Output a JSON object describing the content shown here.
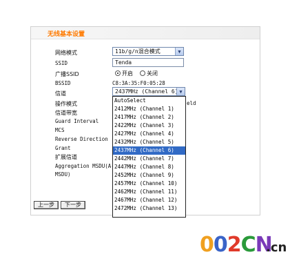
{
  "panel": {
    "title": "无线基本设置"
  },
  "form": {
    "network_mode": {
      "label": "网络模式",
      "value": "11b/g/n混合模式"
    },
    "ssid": {
      "label": "SSID",
      "value": "Tenda"
    },
    "broadcast_ssid": {
      "label": "广播SSID",
      "on_label": "开启",
      "off_label": "关闭",
      "selected": "开启"
    },
    "bssid": {
      "label": "BSSID",
      "value": "C8:3A:35:F0:05:28"
    },
    "channel": {
      "label": "信道",
      "value": "2437MHz (Channel 6)"
    },
    "operating_mode": {
      "label": "操作模式",
      "partial_value": "eld"
    },
    "channel_bandwidth": {
      "label": "信道带宽"
    },
    "guard_interval": {
      "label": "Guard Interval"
    },
    "mcs": {
      "label": "MCS"
    },
    "reverse_direction": {
      "label": "Reverse Direction"
    },
    "grant": {
      "label": "Grant"
    },
    "extension_channel": {
      "label": "扩展信道"
    },
    "aggregation_msdu": {
      "label_line1": "Aggregation MSDU(A-",
      "label_line2": "MSDU)"
    }
  },
  "channel_dropdown": {
    "options": [
      "AutoSelect",
      "2412MHz (Channel 1)",
      "2417MHz (Channel 2)",
      "2422MHz (Channel 3)",
      "2427MHz (Channel 4)",
      "2432MHz (Channel 5)",
      "2437MHz (Channel 6)",
      "2442MHz (Channel 7)",
      "2447MHz (Channel 8)",
      "2452MHz (Channel 9)",
      "2457MHz (Channel 10)",
      "2462MHz (Channel 11)",
      "2467MHz (Channel 12)",
      "2472MHz (Channel 13)"
    ],
    "selected": "2437MHz (Channel 6)"
  },
  "buttons": {
    "prev": "上一步",
    "next": "下一步"
  },
  "watermark": {
    "text": "002CN",
    "suffix": ".cn"
  },
  "colors": {
    "title": "#ff7a00",
    "selection": "#316ac5"
  }
}
